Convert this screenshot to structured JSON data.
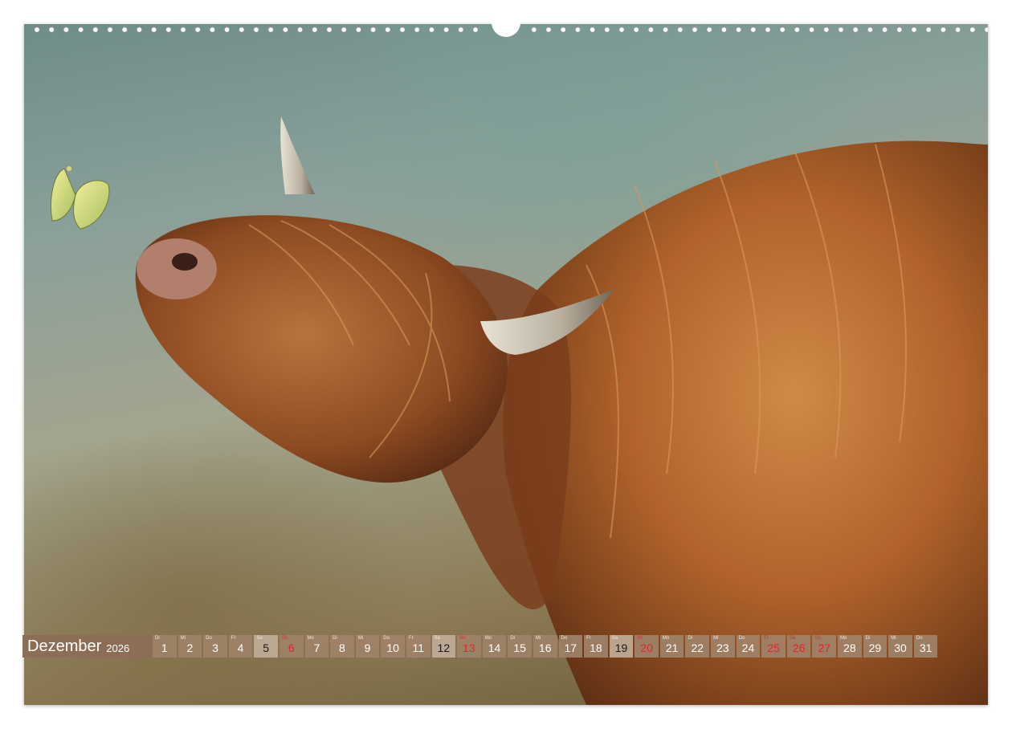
{
  "calendar": {
    "month": "Dezember",
    "year": "2026",
    "days": [
      {
        "wd": "Di",
        "d": "1",
        "t": "n"
      },
      {
        "wd": "Mi",
        "d": "2",
        "t": "n"
      },
      {
        "wd": "Do",
        "d": "3",
        "t": "n"
      },
      {
        "wd": "Fr",
        "d": "4",
        "t": "n"
      },
      {
        "wd": "Sa",
        "d": "5",
        "t": "s"
      },
      {
        "wd": "So",
        "d": "6",
        "t": "h"
      },
      {
        "wd": "Mo",
        "d": "7",
        "t": "n"
      },
      {
        "wd": "Di",
        "d": "8",
        "t": "n"
      },
      {
        "wd": "Mi",
        "d": "9",
        "t": "n"
      },
      {
        "wd": "Do",
        "d": "10",
        "t": "n"
      },
      {
        "wd": "Fr",
        "d": "11",
        "t": "n"
      },
      {
        "wd": "Sa",
        "d": "12",
        "t": "s"
      },
      {
        "wd": "So",
        "d": "13",
        "t": "h"
      },
      {
        "wd": "Mo",
        "d": "14",
        "t": "n"
      },
      {
        "wd": "Di",
        "d": "15",
        "t": "n"
      },
      {
        "wd": "Mi",
        "d": "16",
        "t": "n"
      },
      {
        "wd": "Do",
        "d": "17",
        "t": "n"
      },
      {
        "wd": "Fr",
        "d": "18",
        "t": "n"
      },
      {
        "wd": "Sa",
        "d": "19",
        "t": "s"
      },
      {
        "wd": "So",
        "d": "20",
        "t": "h"
      },
      {
        "wd": "Mo",
        "d": "21",
        "t": "n"
      },
      {
        "wd": "Di",
        "d": "22",
        "t": "n"
      },
      {
        "wd": "Mi",
        "d": "23",
        "t": "n"
      },
      {
        "wd": "Do",
        "d": "24",
        "t": "n"
      },
      {
        "wd": "Fr",
        "d": "25",
        "t": "h"
      },
      {
        "wd": "Sa",
        "d": "26",
        "t": "h"
      },
      {
        "wd": "So",
        "d": "27",
        "t": "h"
      },
      {
        "wd": "Mo",
        "d": "28",
        "t": "n"
      },
      {
        "wd": "Di",
        "d": "29",
        "t": "n"
      },
      {
        "wd": "Mi",
        "d": "30",
        "t": "n"
      },
      {
        "wd": "Do",
        "d": "31",
        "t": "n"
      }
    ]
  },
  "colors": {
    "holiday": "#e8222a",
    "cell": "#a08269",
    "month_cell": "#8b6e55",
    "fur": "#b0622a"
  }
}
